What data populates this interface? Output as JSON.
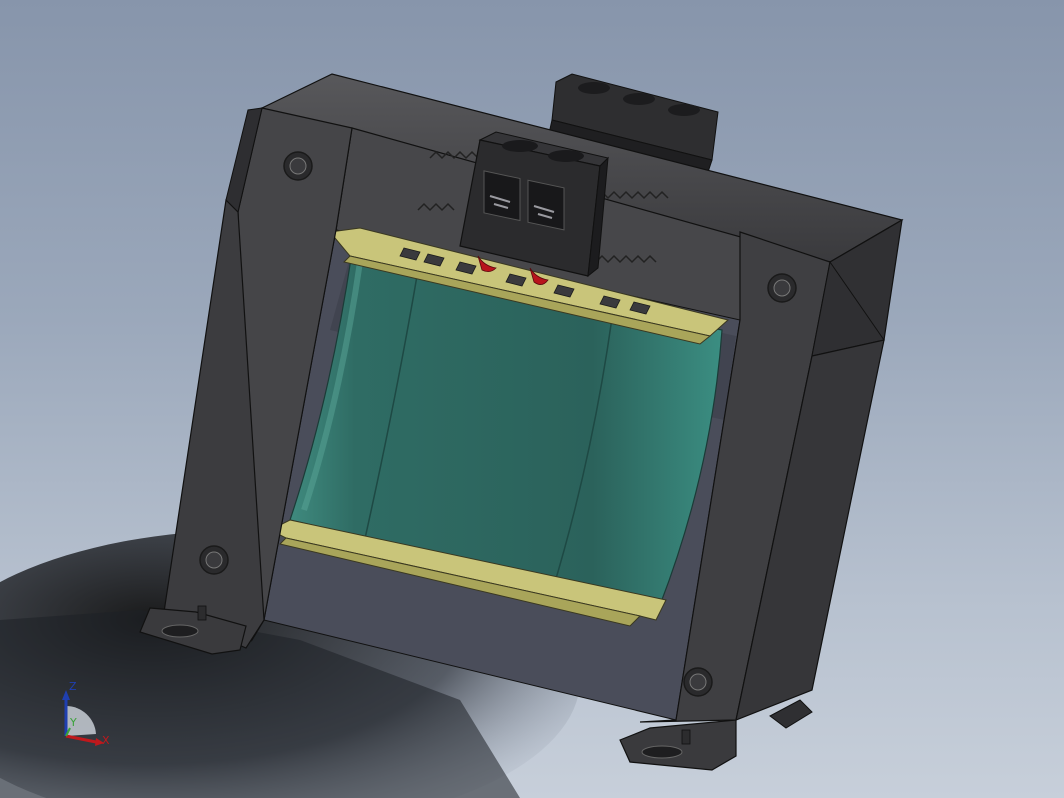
{
  "viewport": {
    "background_top": "#8795ab",
    "background_bottom": "#c7cfda"
  },
  "model": {
    "frame_color": "#3f3f41",
    "coil_color": "#2e6a62",
    "bobbin_color": "#c8c478",
    "wire_color": "#b8141c",
    "terminal_block_color": "#2b2b2d"
  },
  "triad": {
    "x_label": "X",
    "y_label": "Y",
    "z_label": "Z",
    "x_color": "#c0181c",
    "y_color": "#3aa23a",
    "z_color": "#1f3fb0"
  }
}
